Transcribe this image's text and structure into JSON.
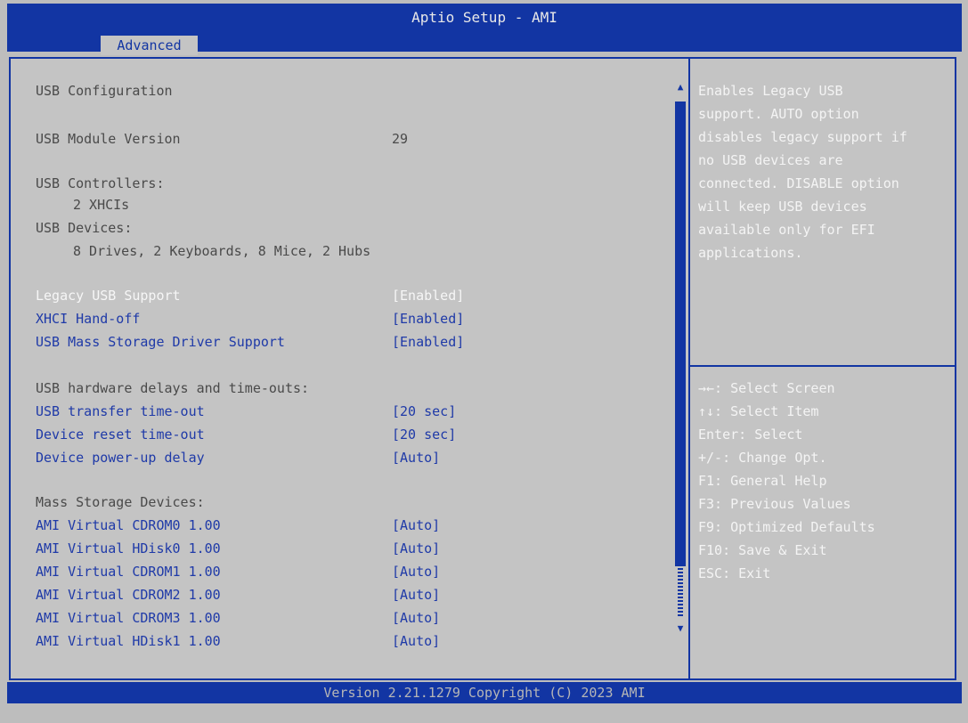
{
  "header": {
    "title": "Aptio Setup - AMI",
    "tab_label": "Advanced"
  },
  "left": {
    "section_title": "USB Configuration",
    "module_version_label": "USB Module Version",
    "module_version_value": "29",
    "controllers_label": "USB Controllers:",
    "controllers_value": "2 XHCIs",
    "devices_label": "USB Devices:",
    "devices_value": "8 Drives, 2 Keyboards, 8 Mice, 2 Hubs",
    "settings": [
      {
        "label": "Legacy USB Support",
        "value": "[Enabled]"
      },
      {
        "label": "XHCI Hand-off",
        "value": "[Enabled]"
      },
      {
        "label": "USB Mass Storage Driver Support",
        "value": "[Enabled]"
      }
    ],
    "delays_title": "USB hardware delays and time-outs:",
    "delays": [
      {
        "label": "USB transfer time-out",
        "value": "[20 sec]"
      },
      {
        "label": "Device reset time-out",
        "value": "[20 sec]"
      },
      {
        "label": "Device power-up delay",
        "value": "[Auto]"
      }
    ],
    "mass_title": "Mass Storage Devices:",
    "mass_devices": [
      {
        "label": "AMI Virtual CDROM0 1.00",
        "value": "[Auto]"
      },
      {
        "label": "AMI Virtual HDisk0 1.00",
        "value": "[Auto]"
      },
      {
        "label": "AMI Virtual CDROM1 1.00",
        "value": "[Auto]"
      },
      {
        "label": "AMI Virtual CDROM2 1.00",
        "value": "[Auto]"
      },
      {
        "label": "AMI Virtual CDROM3 1.00",
        "value": "[Auto]"
      },
      {
        "label": "AMI Virtual HDisk1 1.00",
        "value": "[Auto]"
      }
    ]
  },
  "scrollbar": {
    "up_glyph": "▲",
    "down_glyph": "▼",
    "thumb_fraction": 0.9
  },
  "help": {
    "lines": [
      "Enables Legacy USB",
      "support. AUTO option",
      "disables legacy support if",
      "no USB devices are",
      "connected. DISABLE option",
      "will keep USB devices",
      "available only for EFI",
      "applications."
    ],
    "keys": [
      "→←: Select Screen",
      "↑↓: Select Item",
      "Enter: Select",
      "+/-: Change Opt.",
      "F1: General Help",
      "F3: Previous Values",
      "F9: Optimized Defaults",
      "F10: Save & Exit",
      "ESC: Exit"
    ]
  },
  "footer": {
    "version": "Version 2.21.1279 Copyright (C) 2023 AMI"
  },
  "colors": {
    "bar_blue": "#1235a3",
    "panel_gray": "#c4c4c4",
    "option_blue": "#1f3aa8",
    "highlight_white": "#f6f6f6"
  }
}
